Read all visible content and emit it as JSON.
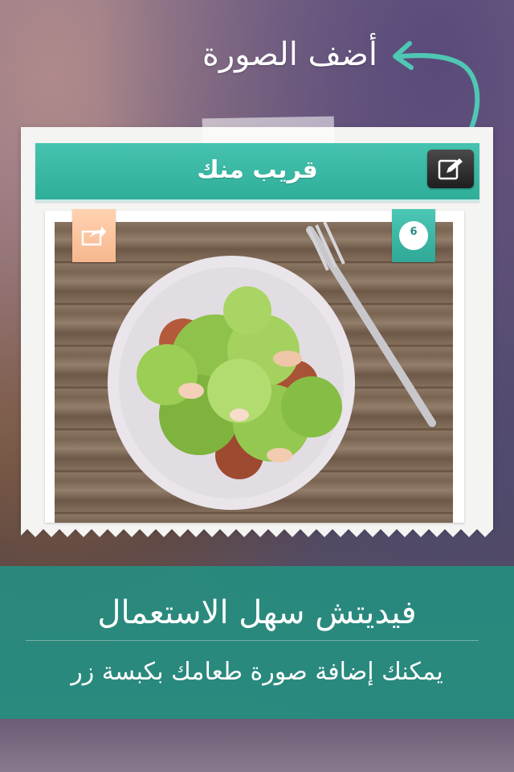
{
  "top_caption": "أضف الصورة",
  "card": {
    "title": "قريب منك",
    "count": "6"
  },
  "footer": {
    "title": "فيديتش سهل الاستعمال",
    "subtitle": "يمكنك إضافة صورة طعامك بكبسة زر"
  },
  "icons": {
    "edit": "edit-icon",
    "share": "share-icon",
    "count": "plate-counter-icon",
    "arrow": "curved-arrow-icon"
  },
  "colors": {
    "accent": "#2fae99",
    "share": "#f6b88e",
    "panel": "#268c7e"
  }
}
